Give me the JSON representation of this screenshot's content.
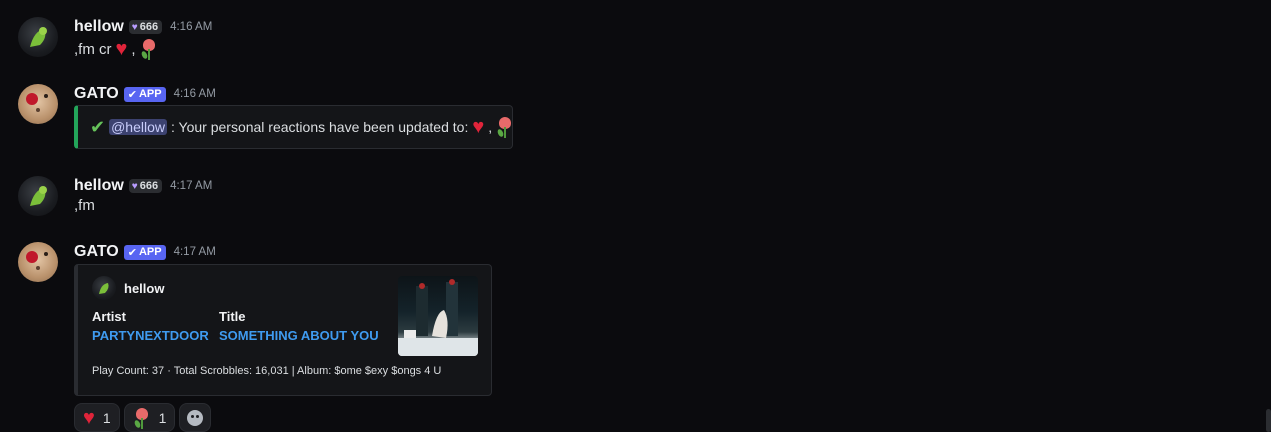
{
  "messages": [
    {
      "username": "hellow",
      "badge": "666",
      "time": "4:16 AM",
      "text": ",fm cr",
      "separator": ","
    },
    {
      "username": "GATO",
      "badge": "APP",
      "time": "4:16 AM",
      "embed_mention": "@hellow",
      "embed_text": " : Your personal reactions have been updated to:",
      "embed_sep": ","
    },
    {
      "username": "hellow",
      "badge": "666",
      "time": "4:17 AM",
      "text": ",fm"
    },
    {
      "username": "GATO",
      "badge": "APP",
      "time": "4:17 AM",
      "embed": {
        "author": "hellow",
        "fields": [
          {
            "name": "Artist",
            "value": "PARTYNEXTDOOR"
          },
          {
            "name": "Title",
            "value": "SOMETHING ABOUT YOU"
          }
        ],
        "footer": "Play Count: 37 · Total Scrobbles: 16,031 | Album: $ome $exy $ongs 4 U"
      }
    }
  ],
  "reactions": [
    {
      "emoji": "heart-icon",
      "count": "1"
    },
    {
      "emoji": "tulip-icon",
      "count": "1"
    }
  ],
  "colors": {
    "accent_green": "#23a55a",
    "link_blue": "#3f9bf0",
    "app_badge": "#5865f2"
  }
}
